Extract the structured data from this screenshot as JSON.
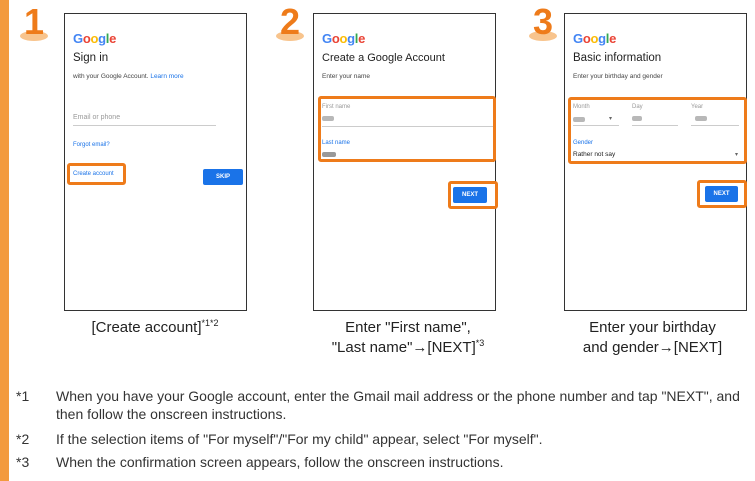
{
  "steps": [
    {
      "number": "1",
      "logo": "Google",
      "title": "Sign in",
      "subtitle": "with your Google Account.",
      "subtitle_link": "Learn more",
      "field_placeholder": "Email or phone",
      "forgot_link": "Forgot email?",
      "create_link": "Create account",
      "button": "SKIP",
      "caption": "[Create account]",
      "caption_sup": "*1*2"
    },
    {
      "number": "2",
      "logo": "Google",
      "title": "Create a Google Account",
      "subtitle": "Enter your name",
      "first_name_label": "First name",
      "last_name_label": "Last name",
      "button": "NEXT",
      "caption_line1": "Enter \"First name\",",
      "caption_line2": "\"Last name\"→[NEXT]",
      "caption_sup": "*3"
    },
    {
      "number": "3",
      "logo": "Google",
      "title": "Basic information",
      "subtitle": "Enter your birthday and gender",
      "month_label": "Month",
      "day_label": "Day",
      "year_label": "Year",
      "gender_label": "Gender",
      "gender_value": "Rather not say",
      "button": "NEXT",
      "caption_line1": "Enter your birthday",
      "caption_line2": "and gender→[NEXT]"
    }
  ],
  "notes": [
    {
      "mark": "*1",
      "text": "When you have your Google account, enter the Gmail mail address or the phone number and tap \"NEXT\", and then follow the onscreen instructions."
    },
    {
      "mark": "*2",
      "text": "If the selection items of \"For myself\"/\"For my child\" appear, select \"For myself\"."
    },
    {
      "mark": "*3",
      "text": "When the confirmation screen appears, follow the onscreen instructions."
    }
  ],
  "colors": {
    "accent_orange": "#ee7b1a",
    "google_blue": "#1a73e8",
    "google_red": "#ea4335",
    "google_yellow": "#fbbc05",
    "google_green": "#34a853"
  }
}
